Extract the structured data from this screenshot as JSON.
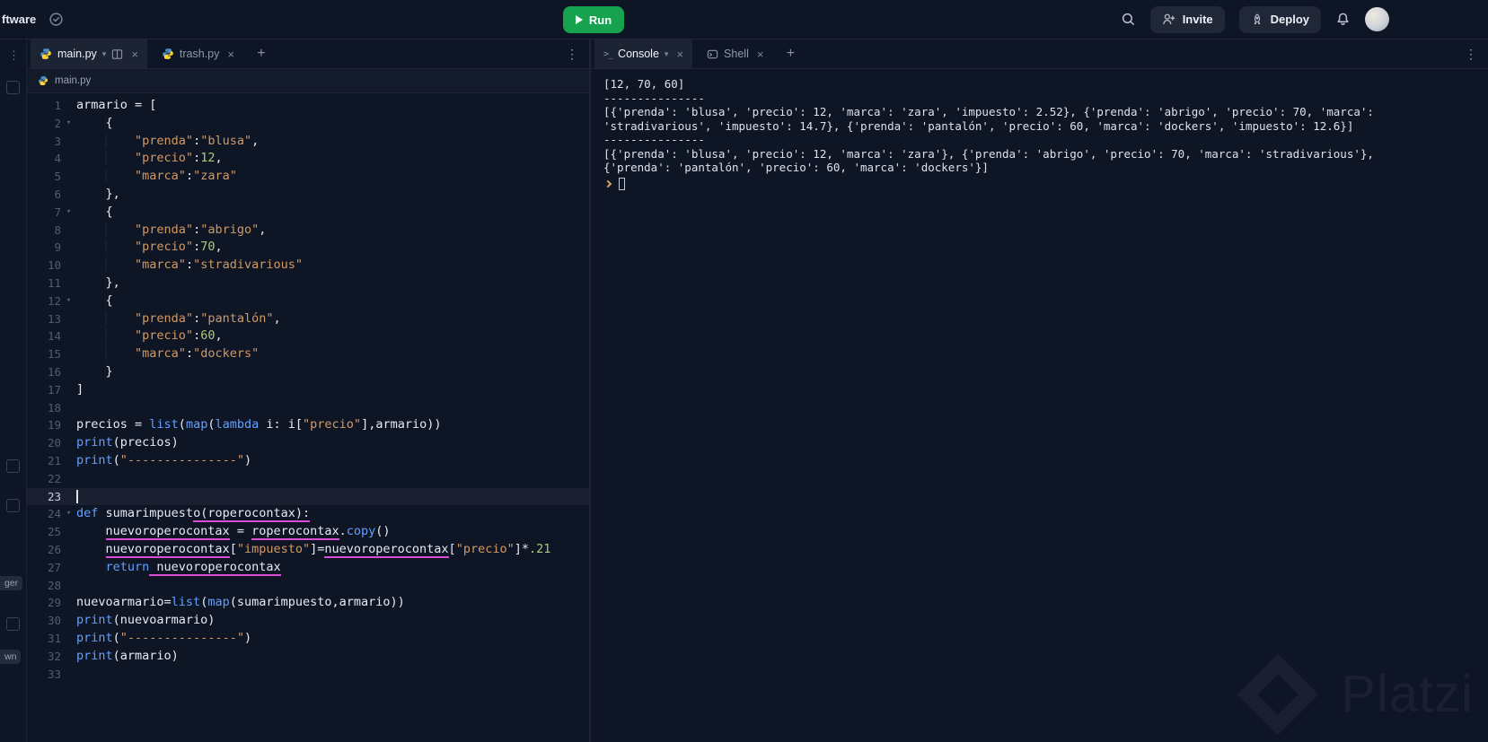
{
  "topbar": {
    "workspace_label": "ftware",
    "run_label": "Run",
    "invite_label": "Invite",
    "deploy_label": "Deploy"
  },
  "left_rail": {
    "badge_top": "ger",
    "badge_bottom": "wn"
  },
  "editor": {
    "tabs": [
      {
        "label": "main.py"
      },
      {
        "label": "trash.py"
      }
    ],
    "breadcrumb": "main.py",
    "lines": [
      {
        "n": 1,
        "tokens": [
          [
            "p",
            "armario = ["
          ]
        ]
      },
      {
        "n": 2,
        "fold": true,
        "tokens": [
          [
            "w",
            "    "
          ],
          [
            "p",
            "{"
          ]
        ]
      },
      {
        "n": 3,
        "tokens": [
          [
            "w",
            "        "
          ],
          [
            "s",
            "\"prenda\""
          ],
          [
            "p",
            ":"
          ],
          [
            "s",
            "\"blusa\""
          ],
          [
            "p",
            ","
          ]
        ]
      },
      {
        "n": 4,
        "tokens": [
          [
            "w",
            "        "
          ],
          [
            "s",
            "\"precio\""
          ],
          [
            "p",
            ":"
          ],
          [
            "n",
            "12"
          ],
          [
            "p",
            ","
          ]
        ]
      },
      {
        "n": 5,
        "tokens": [
          [
            "w",
            "        "
          ],
          [
            "s",
            "\"marca\""
          ],
          [
            "p",
            ":"
          ],
          [
            "s",
            "\"zara\""
          ]
        ]
      },
      {
        "n": 6,
        "tokens": [
          [
            "w",
            "    "
          ],
          [
            "p",
            "},"
          ]
        ]
      },
      {
        "n": 7,
        "fold": true,
        "tokens": [
          [
            "w",
            "    "
          ],
          [
            "p",
            "{"
          ]
        ]
      },
      {
        "n": 8,
        "tokens": [
          [
            "w",
            "        "
          ],
          [
            "s",
            "\"prenda\""
          ],
          [
            "p",
            ":"
          ],
          [
            "s",
            "\"abrigo\""
          ],
          [
            "p",
            ","
          ]
        ]
      },
      {
        "n": 9,
        "tokens": [
          [
            "w",
            "        "
          ],
          [
            "s",
            "\"precio\""
          ],
          [
            "p",
            ":"
          ],
          [
            "n",
            "70"
          ],
          [
            "p",
            ","
          ]
        ]
      },
      {
        "n": 10,
        "tokens": [
          [
            "w",
            "        "
          ],
          [
            "s",
            "\"marca\""
          ],
          [
            "p",
            ":"
          ],
          [
            "s",
            "\"stradivarious\""
          ]
        ]
      },
      {
        "n": 11,
        "tokens": [
          [
            "w",
            "    "
          ],
          [
            "p",
            "},"
          ]
        ]
      },
      {
        "n": 12,
        "fold": true,
        "tokens": [
          [
            "w",
            "    "
          ],
          [
            "p",
            "{"
          ]
        ]
      },
      {
        "n": 13,
        "tokens": [
          [
            "w",
            "        "
          ],
          [
            "s",
            "\"prenda\""
          ],
          [
            "p",
            ":"
          ],
          [
            "s",
            "\"pantalón\""
          ],
          [
            "p",
            ","
          ]
        ]
      },
      {
        "n": 14,
        "tokens": [
          [
            "w",
            "        "
          ],
          [
            "s",
            "\"precio\""
          ],
          [
            "p",
            ":"
          ],
          [
            "n",
            "60"
          ],
          [
            "p",
            ","
          ]
        ]
      },
      {
        "n": 15,
        "tokens": [
          [
            "w",
            "        "
          ],
          [
            "s",
            "\"marca\""
          ],
          [
            "p",
            ":"
          ],
          [
            "s",
            "\"dockers\""
          ]
        ]
      },
      {
        "n": 16,
        "tokens": [
          [
            "w",
            "    "
          ],
          [
            "p",
            "}"
          ]
        ]
      },
      {
        "n": 17,
        "tokens": [
          [
            "p",
            "]"
          ]
        ]
      },
      {
        "n": 18,
        "tokens": []
      },
      {
        "n": 19,
        "tokens": [
          [
            "p",
            "precios = "
          ],
          [
            "k",
            "list"
          ],
          [
            "p",
            "("
          ],
          [
            "k",
            "map"
          ],
          [
            "p",
            "("
          ],
          [
            "k",
            "lambda"
          ],
          [
            "p",
            " i: i["
          ],
          [
            "s",
            "\"precio\""
          ],
          [
            "p",
            "],armario))"
          ]
        ]
      },
      {
        "n": 20,
        "tokens": [
          [
            "k",
            "print"
          ],
          [
            "p",
            "(precios)"
          ]
        ]
      },
      {
        "n": 21,
        "tokens": [
          [
            "k",
            "print"
          ],
          [
            "p",
            "("
          ],
          [
            "s",
            "\"---------------\""
          ],
          [
            "p",
            ")"
          ]
        ]
      },
      {
        "n": 22,
        "tokens": []
      },
      {
        "n": 23,
        "cur": true,
        "tokens": []
      },
      {
        "n": 24,
        "fold": true,
        "tokens": [
          [
            "k",
            "def "
          ],
          [
            "p",
            "sumarimpuest"
          ],
          [
            "pu",
            "o(roperocontax):"
          ]
        ]
      },
      {
        "n": 25,
        "tokens": [
          [
            "w",
            "    "
          ],
          [
            "pu",
            "nuevoroperocontax"
          ],
          [
            "p",
            " = "
          ],
          [
            "pu",
            "roperocontax"
          ],
          [
            "p",
            "."
          ],
          [
            "k",
            "copy"
          ],
          [
            "p",
            "()"
          ]
        ]
      },
      {
        "n": 26,
        "tokens": [
          [
            "w",
            "    "
          ],
          [
            "pu",
            "nuevoroperocontax"
          ],
          [
            "p",
            "["
          ],
          [
            "s",
            "\"impuesto\""
          ],
          [
            "p",
            "]="
          ],
          [
            "pu",
            "nuevoroperocontax"
          ],
          [
            "p",
            "["
          ],
          [
            "s",
            "\"precio\""
          ],
          [
            "p",
            "]*"
          ],
          [
            "n",
            ".21"
          ]
        ]
      },
      {
        "n": 27,
        "tokens": [
          [
            "w",
            "    "
          ],
          [
            "k",
            "return"
          ],
          [
            "pu",
            " nuevoroperocontax"
          ]
        ]
      },
      {
        "n": 28,
        "tokens": []
      },
      {
        "n": 29,
        "tokens": [
          [
            "p",
            "nuevoarmario="
          ],
          [
            "k",
            "list"
          ],
          [
            "p",
            "("
          ],
          [
            "k",
            "map"
          ],
          [
            "p",
            "(sumarimpuesto,armario))"
          ]
        ]
      },
      {
        "n": 30,
        "tokens": [
          [
            "k",
            "print"
          ],
          [
            "p",
            "(nuevoarmario)"
          ]
        ]
      },
      {
        "n": 31,
        "tokens": [
          [
            "k",
            "print"
          ],
          [
            "p",
            "("
          ],
          [
            "s",
            "\"---------------\""
          ],
          [
            "p",
            ")"
          ]
        ]
      },
      {
        "n": 32,
        "tokens": [
          [
            "k",
            "print"
          ],
          [
            "p",
            "(armario)"
          ]
        ]
      },
      {
        "n": 33,
        "tokens": []
      }
    ]
  },
  "console": {
    "tabs": [
      {
        "label": "Console"
      },
      {
        "label": "Shell"
      }
    ],
    "output": [
      "[12, 70, 60]",
      "---------------",
      "[{'prenda': 'blusa', 'precio': 12, 'marca': 'zara', 'impuesto': 2.52}, {'prenda': 'abrigo', 'precio': 70, 'marca': 'stradivarious', 'impuesto': 14.7}, {'prenda': 'pantalón', 'precio': 60, 'marca': 'dockers', 'impuesto': 12.6}]",
      "---------------",
      "[{'prenda': 'blusa', 'precio': 12, 'marca': 'zara'}, {'prenda': 'abrigo', 'precio': 70, 'marca': 'stradivarious'}, {'prenda': 'pantalón', 'precio': 60, 'marca': 'dockers'}]"
    ]
  },
  "watermark": "Platzi",
  "colors": {
    "accent_green": "#17a24f",
    "string_orange": "#d19a66",
    "number_green": "#b0c97a",
    "keyword_blue": "#61a0ff",
    "underline_magenta": "#d94ed4"
  }
}
